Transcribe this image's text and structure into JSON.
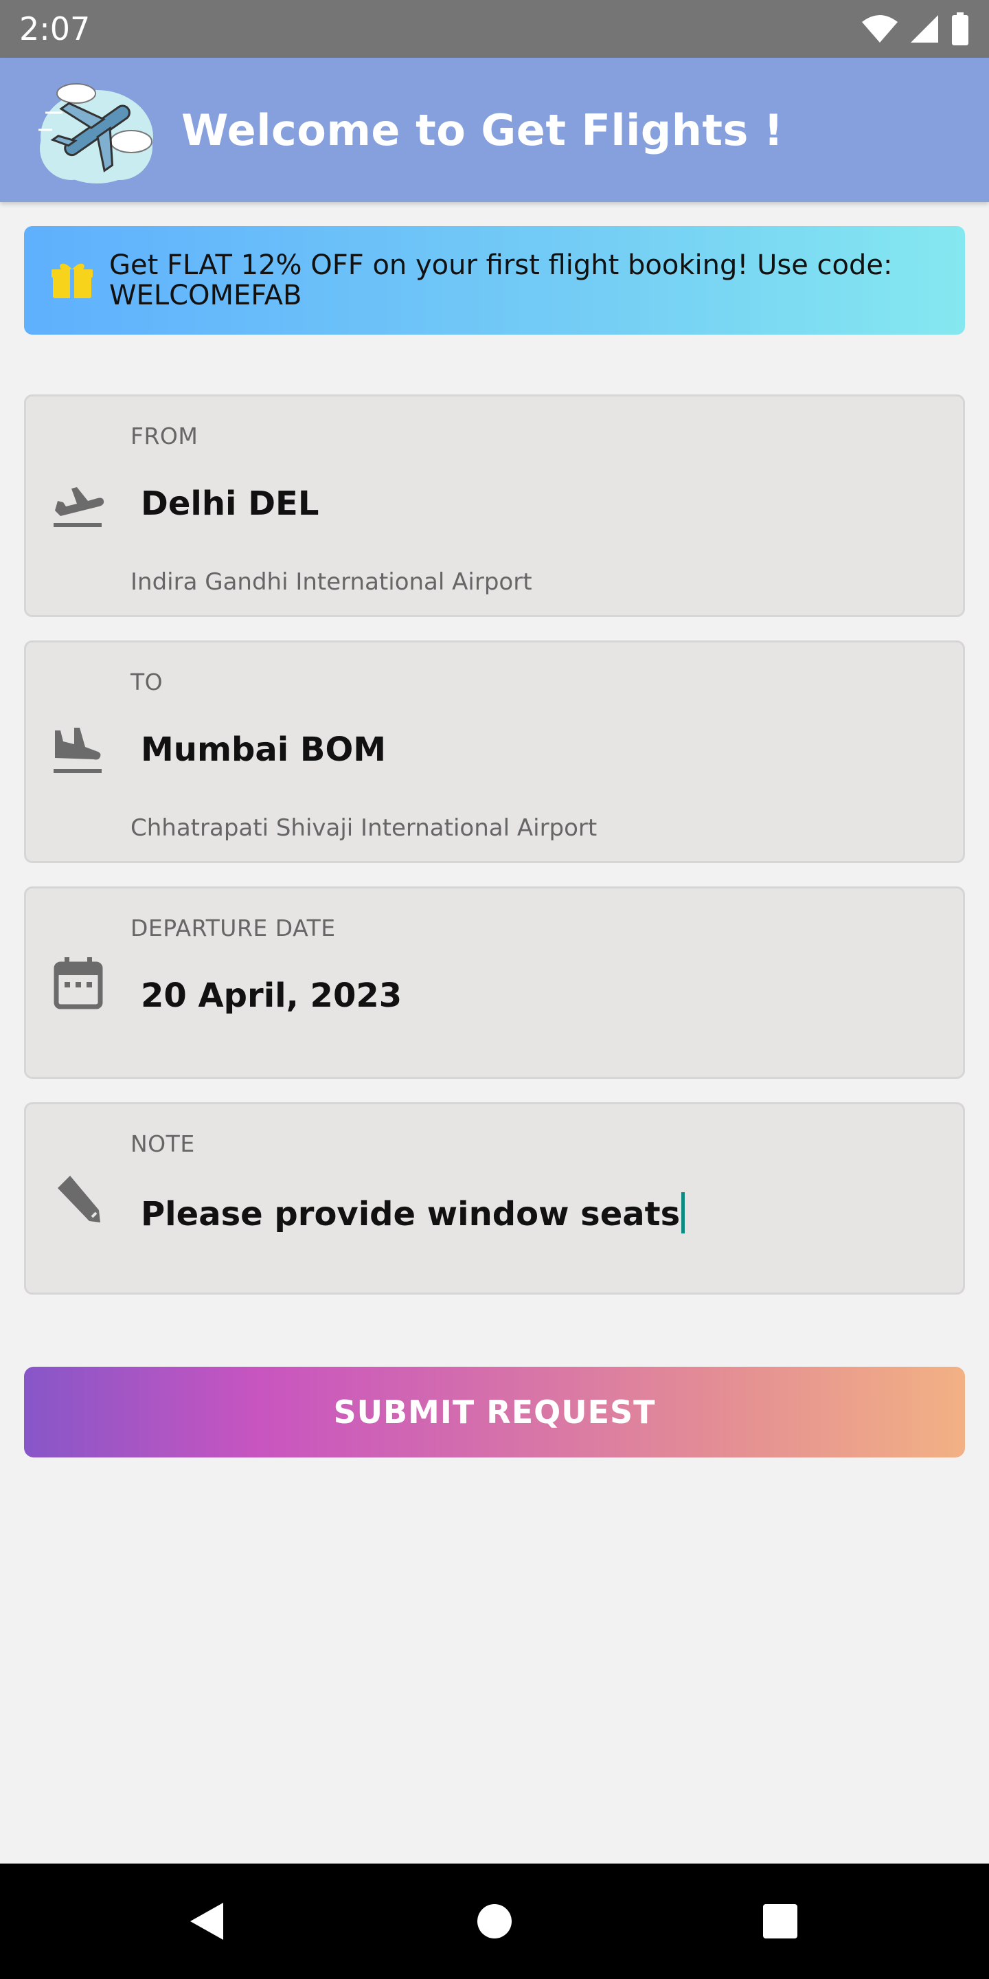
{
  "status_bar": {
    "time": "2:07",
    "icons": [
      "wifi-icon",
      "cellular-signal-icon",
      "battery-icon"
    ]
  },
  "app_bar": {
    "title": "Welcome to Get Flights !",
    "logo": "airplane-clouds-logo",
    "background": "#869fdd"
  },
  "promo": {
    "icon": "gift-icon",
    "text": "Get FLAT 12% OFF on your first flight booking! Use code: WELCOMEFAB"
  },
  "form": {
    "from": {
      "label": "FROM",
      "value": "Delhi DEL",
      "sub": "Indira Gandhi International Airport",
      "icon": "flight-takeoff-icon"
    },
    "to": {
      "label": "TO",
      "value": "Mumbai BOM",
      "sub": "Chhatrapati Shivaji International Airport",
      "icon": "flight-land-icon"
    },
    "departure": {
      "label": "DEPARTURE DATE",
      "value": "20 April, 2023",
      "icon": "calendar-icon"
    },
    "note": {
      "label": "NOTE",
      "value": "Please provide window seats",
      "icon": "pencil-icon"
    }
  },
  "submit": {
    "label": "SUBMIT REQUEST"
  },
  "nav_bar": {
    "buttons": [
      "back-icon",
      "home-icon",
      "recents-icon"
    ]
  }
}
